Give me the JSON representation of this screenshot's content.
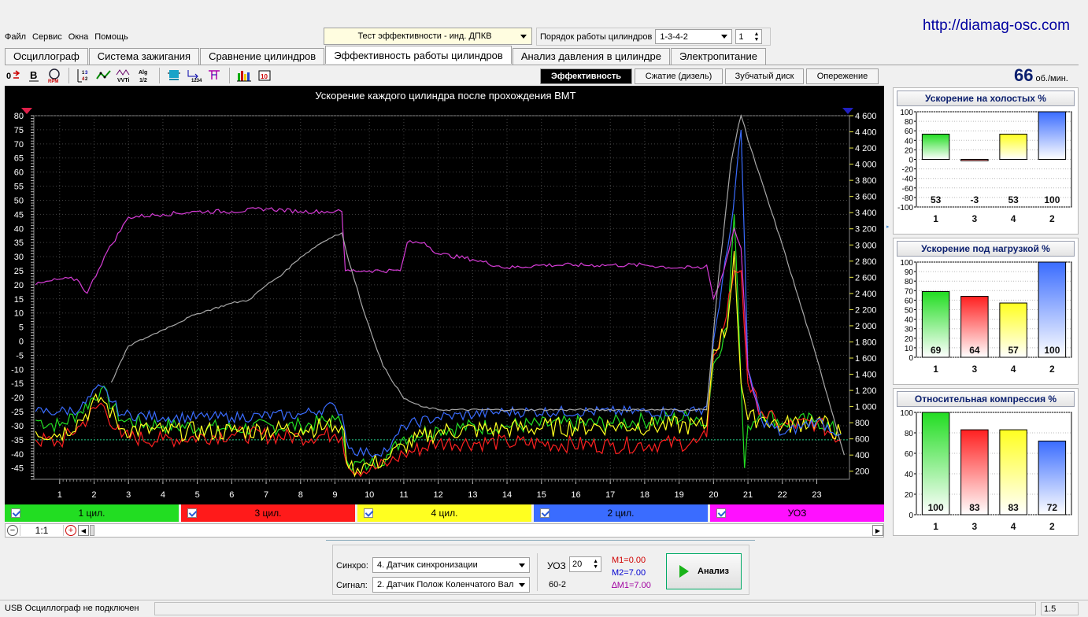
{
  "site_url": "http://diamag-osc.com",
  "menu": [
    "Файл",
    "Сервис",
    "Окна",
    "Помощь"
  ],
  "test_combo": {
    "value": "Тест эффективности - инд. ДПКВ"
  },
  "cyl_order": {
    "label": "Порядок работы цилиндров",
    "value": "1-3-4-2",
    "spin": "1"
  },
  "tabs": [
    "Осциллограф",
    "Система зажигания",
    "Сравнение цилиндров",
    "Эффективность работы цилиндров",
    "Анализ давления в цилиндре",
    "Электропитание"
  ],
  "active_tab": 3,
  "toolbar_icons": [
    "marker-toggle-icon",
    "bold-icon",
    "rpm-icon",
    "cylinder-order-icon",
    "line-style-icon",
    "vvti-icon",
    "algorithm-icon",
    "sensor-icon",
    "numbering-icon",
    "cursor-icon",
    "bar-chart-icon",
    "table-icon"
  ],
  "mode_tabs": [
    "Эффективность",
    "Сжатие (дизель)",
    "Зубчатый диск",
    "Опережение"
  ],
  "rpm": {
    "value": "66",
    "unit": "об./мин."
  },
  "chart_data": {
    "type": "line",
    "title": "Ускорение каждого цилиндра после прохождения ВМТ",
    "x_ticks": [
      "1",
      "2",
      "3",
      "4",
      "5",
      "6",
      "7",
      "8",
      "9",
      "10",
      "11",
      "12",
      "13",
      "14",
      "15",
      "16",
      "17",
      "18",
      "19",
      "20",
      "21",
      "22",
      "23"
    ],
    "xlim": [
      0.25,
      23.95
    ],
    "left_axis": {
      "ticks": [
        "80",
        "75",
        "70",
        "65",
        "60",
        "55",
        "50",
        "45",
        "40",
        "35",
        "30",
        "25",
        "20",
        "15",
        "10",
        "5",
        "0",
        "-5",
        "-10",
        "-15",
        "-20",
        "-25",
        "-30",
        "-35",
        "-40",
        "-45"
      ],
      "ylim": [
        -49,
        80
      ]
    },
    "right_axis": {
      "ticks": [
        "4 600",
        "4 400",
        "4 200",
        "4 000",
        "3 800",
        "3 600",
        "3 400",
        "3 200",
        "3 000",
        "2 800",
        "2 600",
        "2 400",
        "2 200",
        "2 000",
        "1 800",
        "1 600",
        "1 400",
        "1 200",
        "1 000",
        "800",
        "600",
        "400",
        "200"
      ],
      "ylim": [
        100,
        4600
      ]
    },
    "grid": true,
    "reference_line_left": -35,
    "series": [
      {
        "name": "1 цил.",
        "color": "#22dd22",
        "axis": "left",
        "noise": 6,
        "points": [
          [
            0.3,
            -28
          ],
          [
            1.0,
            -30
          ],
          [
            1.6,
            -25
          ],
          [
            2.2,
            -17
          ],
          [
            2.8,
            -28
          ],
          [
            4.0,
            -30
          ],
          [
            6.0,
            -31
          ],
          [
            8.0,
            -30
          ],
          [
            9.0,
            -28
          ],
          [
            9.2,
            -30
          ],
          [
            9.4,
            -44
          ],
          [
            10.0,
            -44
          ],
          [
            10.6,
            -40
          ],
          [
            11.0,
            -34
          ],
          [
            12.0,
            -31
          ],
          [
            14.0,
            -30
          ],
          [
            17.0,
            -29
          ],
          [
            19.5,
            -27
          ],
          [
            19.8,
            -30
          ],
          [
            20.0,
            -8
          ],
          [
            20.4,
            5
          ],
          [
            20.6,
            45
          ],
          [
            20.8,
            -15
          ],
          [
            20.9,
            -45
          ],
          [
            21.0,
            -30
          ],
          [
            21.4,
            -25
          ],
          [
            22.0,
            -29
          ],
          [
            23.0,
            -28
          ],
          [
            23.7,
            -33
          ]
        ]
      },
      {
        "name": "3 цил.",
        "color": "#ff2020",
        "axis": "left",
        "noise": 6,
        "points": [
          [
            0.3,
            -35
          ],
          [
            1.0,
            -36
          ],
          [
            1.6,
            -30
          ],
          [
            2.2,
            -22
          ],
          [
            2.8,
            -34
          ],
          [
            4.0,
            -35
          ],
          [
            6.0,
            -33
          ],
          [
            8.0,
            -34
          ],
          [
            9.0,
            -33
          ],
          [
            9.2,
            -34
          ],
          [
            9.4,
            -45
          ],
          [
            10.0,
            -46
          ],
          [
            10.6,
            -43
          ],
          [
            11.0,
            -40
          ],
          [
            12.0,
            -36
          ],
          [
            14.0,
            -36
          ],
          [
            17.0,
            -37
          ],
          [
            19.5,
            -36
          ],
          [
            19.8,
            -34
          ],
          [
            20.0,
            -5
          ],
          [
            20.3,
            5
          ],
          [
            20.6,
            25
          ],
          [
            20.8,
            25
          ],
          [
            21.0,
            -15
          ],
          [
            21.4,
            -25
          ],
          [
            22.0,
            -30
          ],
          [
            23.0,
            -29
          ],
          [
            23.7,
            -35
          ]
        ]
      },
      {
        "name": "4 цил.",
        "color": "#ffff20",
        "axis": "left",
        "noise": 7,
        "points": [
          [
            0.3,
            -32
          ],
          [
            1.0,
            -33
          ],
          [
            1.6,
            -28
          ],
          [
            2.2,
            -20
          ],
          [
            2.8,
            -31
          ],
          [
            4.0,
            -32
          ],
          [
            6.0,
            -32
          ],
          [
            8.0,
            -31
          ],
          [
            9.0,
            -30
          ],
          [
            9.2,
            -30
          ],
          [
            9.4,
            -45
          ],
          [
            10.0,
            -44
          ],
          [
            10.6,
            -41
          ],
          [
            11.0,
            -37
          ],
          [
            12.0,
            -32
          ],
          [
            14.0,
            -31
          ],
          [
            17.0,
            -30
          ],
          [
            19.5,
            -30
          ],
          [
            19.8,
            -30
          ],
          [
            20.0,
            -3
          ],
          [
            20.4,
            5
          ],
          [
            20.6,
            32
          ],
          [
            20.8,
            -15
          ],
          [
            21.0,
            -28
          ],
          [
            21.4,
            -27
          ],
          [
            22.0,
            -30
          ],
          [
            23.0,
            -28
          ],
          [
            23.7,
            -33
          ]
        ]
      },
      {
        "name": "2 цил.",
        "color": "#3a6cff",
        "axis": "left",
        "noise": 4,
        "points": [
          [
            0.3,
            -25
          ],
          [
            1.0,
            -25
          ],
          [
            1.6,
            -24
          ],
          [
            2.2,
            -16
          ],
          [
            2.8,
            -26
          ],
          [
            4.0,
            -27
          ],
          [
            6.0,
            -27
          ],
          [
            8.0,
            -26
          ],
          [
            9.0,
            -23
          ],
          [
            9.2,
            -26
          ],
          [
            9.4,
            -38
          ],
          [
            10.0,
            -40
          ],
          [
            10.6,
            -38
          ],
          [
            11.0,
            -30
          ],
          [
            12.0,
            -27
          ],
          [
            14.0,
            -25
          ],
          [
            17.0,
            -25
          ],
          [
            19.5,
            -25
          ],
          [
            19.8,
            -23
          ],
          [
            20.0,
            0
          ],
          [
            20.5,
            40
          ],
          [
            20.8,
            75
          ],
          [
            21.0,
            -10
          ],
          [
            21.4,
            -28
          ],
          [
            22.0,
            -33
          ],
          [
            23.0,
            -28
          ],
          [
            23.7,
            -33
          ]
        ]
      },
      {
        "name": "УОЗ",
        "color": "#d63cd6",
        "axis": "left",
        "noise": 1.5,
        "points": [
          [
            0.3,
            20
          ],
          [
            1.0,
            22
          ],
          [
            1.5,
            22
          ],
          [
            1.8,
            17
          ],
          [
            2.3,
            30
          ],
          [
            3.0,
            44
          ],
          [
            4.0,
            45
          ],
          [
            5.0,
            46
          ],
          [
            6.0,
            46
          ],
          [
            7.0,
            47
          ],
          [
            8.0,
            46
          ],
          [
            9.0,
            46
          ],
          [
            9.2,
            46
          ],
          [
            9.3,
            25
          ],
          [
            10.0,
            25
          ],
          [
            10.9,
            25
          ],
          [
            11.1,
            35
          ],
          [
            11.6,
            35
          ],
          [
            12.0,
            31
          ],
          [
            13.0,
            29
          ],
          [
            14.0,
            26
          ],
          [
            15.0,
            27
          ],
          [
            16.0,
            27
          ],
          [
            17.0,
            27
          ],
          [
            18.0,
            27
          ],
          [
            19.0,
            26
          ],
          [
            19.7,
            26
          ],
          [
            19.8,
            27
          ],
          [
            20.0,
            15
          ],
          [
            20.3,
            25
          ],
          [
            20.6,
            40
          ],
          [
            20.8,
            33
          ],
          [
            21.0,
            -10
          ],
          [
            21.3,
            -25
          ]
        ]
      },
      {
        "name": "Обороты",
        "color": "#a8a8a8",
        "axis": "right",
        "noise": 25,
        "points": [
          [
            2.5,
            1300
          ],
          [
            3.0,
            1750
          ],
          [
            3.5,
            1850
          ],
          [
            4.0,
            1950
          ],
          [
            5.0,
            2150
          ],
          [
            6.0,
            2280
          ],
          [
            6.5,
            2320
          ],
          [
            7.0,
            2500
          ],
          [
            7.5,
            2650
          ],
          [
            8.0,
            2850
          ],
          [
            8.5,
            3000
          ],
          [
            9.0,
            3120
          ],
          [
            9.2,
            3150
          ],
          [
            9.4,
            2800
          ],
          [
            9.9,
            2100
          ],
          [
            10.4,
            1500
          ],
          [
            11.0,
            1100
          ],
          [
            11.5,
            1000
          ],
          [
            12.0,
            960
          ],
          [
            19.8,
            960
          ],
          [
            20.1,
            2400
          ],
          [
            20.5,
            4000
          ],
          [
            20.8,
            4650
          ],
          [
            21.0,
            4300
          ],
          [
            22.0,
            3000
          ],
          [
            23.0,
            1600
          ],
          [
            23.8,
            400
          ]
        ]
      }
    ]
  },
  "legend": [
    "1 цил.",
    "3 цил.",
    "4 цил.",
    "2 цил.",
    "УОЗ"
  ],
  "legend_colors": [
    "#22dd22",
    "#ff2020",
    "#ffff20",
    "#3a6cff",
    "#ff10ff"
  ],
  "scroll": {
    "zoom": "1:1"
  },
  "panels": [
    {
      "title": "Ускорение на холостых %",
      "ticks": [
        "100",
        "80",
        "60",
        "40",
        "20",
        "0",
        "-20",
        "-40",
        "-60",
        "-80",
        "-100"
      ],
      "ylim": [
        -100,
        100
      ],
      "categories": [
        "1",
        "3",
        "4",
        "2"
      ],
      "values": [
        53,
        -3,
        53,
        100
      ],
      "labels": [
        "53",
        "-3",
        "53",
        "100"
      ],
      "colors": [
        "#22dd22",
        "#ff2020",
        "#ffff20",
        "#3a6cff"
      ]
    },
    {
      "title": "Ускорение под нагрузкой %",
      "ticks": [
        "100",
        "90",
        "80",
        "70",
        "60",
        "50",
        "40",
        "30",
        "20",
        "10",
        "0"
      ],
      "ylim": [
        0,
        100
      ],
      "categories": [
        "1",
        "3",
        "4",
        "2"
      ],
      "values": [
        69,
        64,
        57,
        100
      ],
      "labels": [
        "69",
        "64",
        "57",
        "100"
      ],
      "colors": [
        "#22dd22",
        "#ff2020",
        "#ffff20",
        "#3a6cff"
      ]
    },
    {
      "title": "Относительная компрессия %",
      "ticks": [
        "100",
        "80",
        "60",
        "40",
        "20",
        "0"
      ],
      "ylim": [
        0,
        100
      ],
      "categories": [
        "1",
        "3",
        "4",
        "2"
      ],
      "values": [
        100,
        83,
        83,
        72
      ],
      "labels": [
        "100",
        "83",
        "83",
        "72"
      ],
      "colors": [
        "#22dd22",
        "#ff2020",
        "#ffff20",
        "#3a6cff"
      ]
    }
  ],
  "bottom": {
    "sync_label": "Синхро:",
    "sync_value": "4.  Датчик синхронизации",
    "signal_label": "Сигнал:",
    "signal_value": "2.  Датчик Полож Коленчатого Вал",
    "uoz_label": "УОЗ",
    "uoz_value": "20",
    "teeth": "60-2",
    "m1": "M1=0.00",
    "m2": "M2=7.00",
    "dm": "∆M1=7.00",
    "analyze_label": "Анализ"
  },
  "status": {
    "left": "USB Осциллограф не подключен",
    "right": "1.5"
  }
}
